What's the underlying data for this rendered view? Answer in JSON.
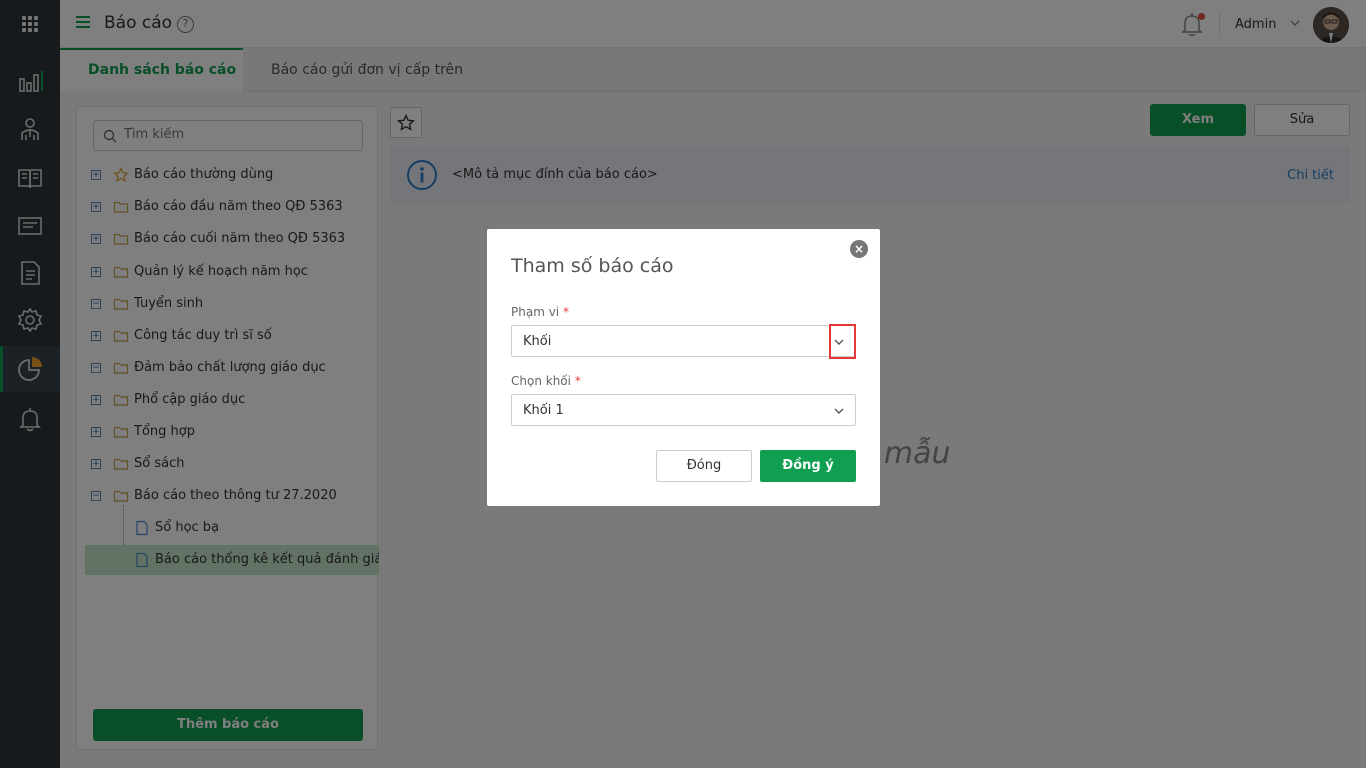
{
  "header": {
    "title": "Báo cáo",
    "help": "?",
    "user_name": "Admin"
  },
  "tabs": [
    {
      "label": "Danh sách báo cáo"
    },
    {
      "label": "Báo cáo gửi đơn vị cấp trên"
    }
  ],
  "sidebar": {
    "search_placeholder": "Tìm kiếm",
    "items": [
      {
        "label": "Báo cáo thường dùng",
        "icon": "star-icon"
      },
      {
        "label": "Báo cáo đầu năm theo QĐ 5363",
        "icon": "folder-icon"
      },
      {
        "label": "Báo cáo cuối năm theo QĐ 5363",
        "icon": "folder-icon"
      },
      {
        "label": "Quản lý kế hoạch năm học",
        "icon": "folder-icon"
      },
      {
        "label": "Tuyển sinh",
        "icon": "folder-icon"
      },
      {
        "label": "Công tác duy trì sĩ số",
        "icon": "folder-icon"
      },
      {
        "label": "Đảm bảo chất lượng giáo dục",
        "icon": "folder-icon"
      },
      {
        "label": "Phổ cập giáo dục",
        "icon": "folder-icon"
      },
      {
        "label": "Tổng hợp",
        "icon": "folder-icon"
      },
      {
        "label": "Sổ sách",
        "icon": "folder-icon"
      },
      {
        "label": "Báo cáo theo thông tư 27.2020",
        "icon": "folder-icon"
      },
      {
        "label": "Sổ học bạ",
        "icon": "file-icon"
      },
      {
        "label": "Báo cáo thống kê kết quả đánh giá xế",
        "icon": "file-icon"
      }
    ],
    "add_button": "Thêm báo cáo"
  },
  "toolbar": {
    "view_label": "Xem",
    "edit_label": "Sửa"
  },
  "info": {
    "description": "<Mô tả mục đính của báo cáo>",
    "detail_link": "Chi tiết"
  },
  "main": {
    "empty_text": "o mẫu"
  },
  "dialog": {
    "title": "Tham số báo cáo",
    "close": "×",
    "scope_label": "Phạm vi",
    "scope_value": "Khối",
    "grade_label": "Chọn khối",
    "grade_value": "Khối 1",
    "required_mark": "*",
    "cancel_label": "Đóng",
    "ok_label": "Đồng ý"
  },
  "colors": {
    "brand_green": "#109e50",
    "rail": "#2c3438",
    "highlight": "#e53935"
  }
}
